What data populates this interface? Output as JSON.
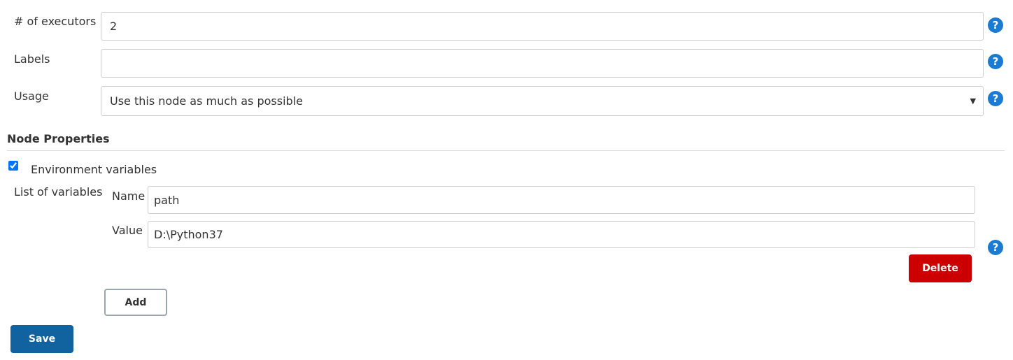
{
  "executors": {
    "label": "# of executors",
    "value": "2"
  },
  "labels": {
    "label": "Labels",
    "value": ""
  },
  "usage": {
    "label": "Usage",
    "value": "Use this node as much as possible"
  },
  "node_properties": {
    "title": "Node Properties",
    "env_vars": {
      "label": "Environment variables",
      "checked": true,
      "list_label": "List of variables",
      "name_label": "Name",
      "name_value": "path",
      "value_label": "Value",
      "value_value": "D:\\Python37",
      "delete_label": "Delete",
      "add_label": "Add"
    }
  },
  "save_label": "Save",
  "help_glyph": "?",
  "colors": {
    "help": "#1b7ad2",
    "delete": "#cc0000",
    "save": "#1163a0"
  }
}
